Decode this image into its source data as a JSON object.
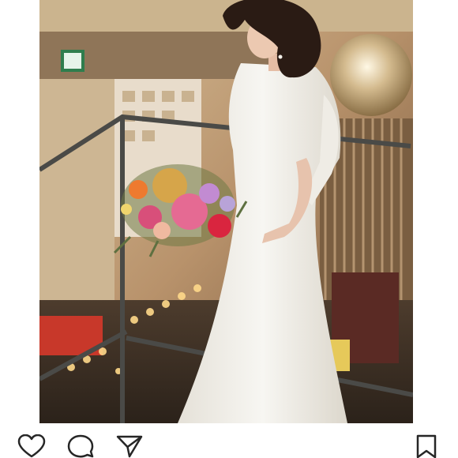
{
  "post": {
    "image": {
      "description_icon": "photo"
    }
  },
  "actions": {
    "like_icon": "heart-outline-icon",
    "comment_icon": "comment-bubble-icon",
    "share_icon": "paper-plane-icon",
    "save_icon": "bookmark-icon"
  },
  "colors": {
    "background": "#ffffff",
    "icon_stroke": "#262626",
    "dress": "#f1efe9"
  }
}
